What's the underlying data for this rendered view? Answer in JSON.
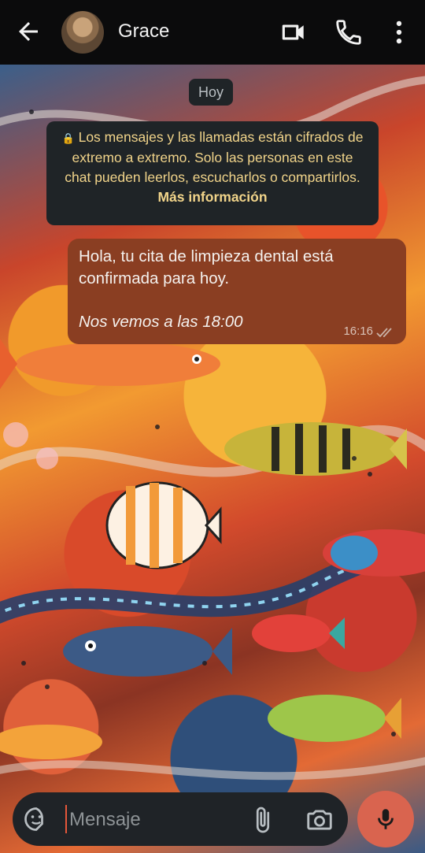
{
  "header": {
    "contact_name": "Grace",
    "icons": [
      "back-arrow-icon",
      "avatar",
      "video-call-icon",
      "phone-icon",
      "more-vert-icon"
    ]
  },
  "chat": {
    "date_chip": "Hoy",
    "encryption_notice": {
      "text": "Los mensajes y las llamadas están cifrados de extremo a extremo. Solo las personas en este chat pueden leerlos, escucharlos o compartirlos.",
      "link": "Más información"
    },
    "messages": [
      {
        "line1": "Hola, tu cita de limpieza dental está confirmada para hoy.",
        "line2": "Nos vemos a las 18:00",
        "time": "16:16",
        "status": "delivered"
      }
    ]
  },
  "composer": {
    "placeholder": "Mensaje",
    "icons": [
      "sticker-icon",
      "attach-icon",
      "camera-icon",
      "mic-icon"
    ]
  },
  "colors": {
    "header_bg": "#0b0b0c",
    "bubble": "#8a3e22",
    "notice_text": "#f1d48a",
    "mic_button": "#d9644f"
  }
}
